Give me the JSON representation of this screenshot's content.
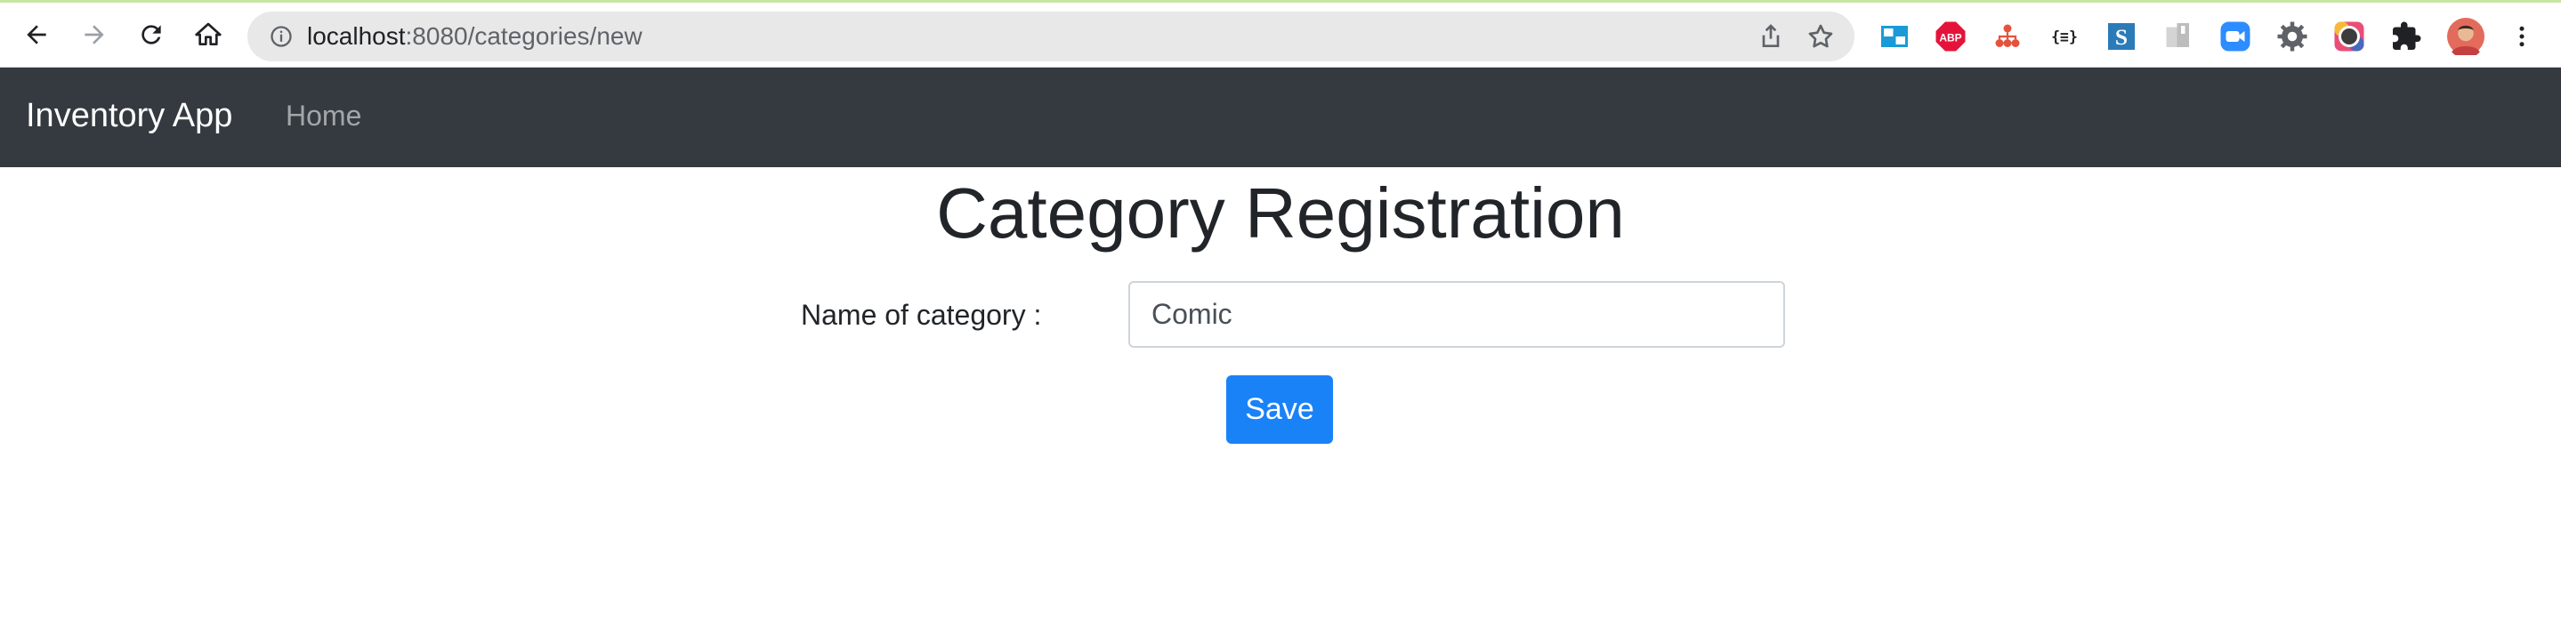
{
  "browser": {
    "url_host": "localhost",
    "url_path": ":8080/categories/new",
    "extensions": [
      {
        "name": "tab-manager-extension",
        "color": "#1a9bd7"
      },
      {
        "name": "adblock-plus-extension",
        "label": "ABP",
        "color": "#e5133a"
      },
      {
        "name": "hierarchy-extension",
        "color": "#e5533c"
      },
      {
        "name": "json-extension",
        "label": "{≡}",
        "color": "#202124"
      },
      {
        "name": "s-extension",
        "label": "S",
        "color": "#2b7bb9"
      },
      {
        "name": "bookmark-extension",
        "color": "#c9c9c9"
      },
      {
        "name": "zoom-extension",
        "color": "#2d8cff"
      },
      {
        "name": "settings-extension",
        "color": "#5f6368"
      },
      {
        "name": "color-ring-extension",
        "color": "#9b51e0"
      },
      {
        "name": "extensions-puzzle",
        "color": "#202124"
      }
    ]
  },
  "navbar": {
    "brand": "Inventory App",
    "home_link": "Home"
  },
  "page": {
    "title": "Category Registration",
    "form": {
      "name_label": "Name of category :",
      "name_value": "Comic",
      "save_label": "Save"
    }
  },
  "colors": {
    "navbar_bg": "#343a40",
    "primary": "#1a82f7"
  }
}
